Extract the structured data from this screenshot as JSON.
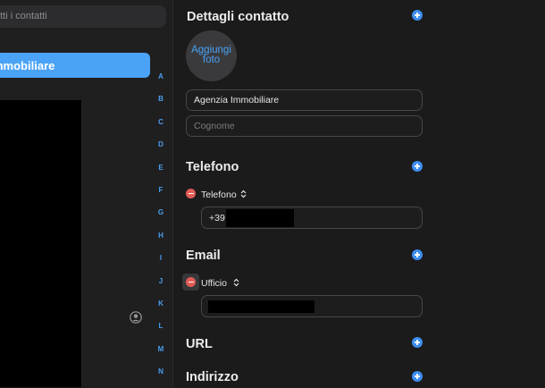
{
  "sidebar": {
    "search_placeholder": "utti i contatti",
    "selected_contact": "mmobiliare",
    "index_letters": [
      "A",
      "B",
      "C",
      "D",
      "E",
      "F",
      "G",
      "H",
      "I",
      "J",
      "K",
      "L",
      "M",
      "N"
    ],
    "me_icon": "person-circle-icon"
  },
  "details": {
    "title": "Dettagli contatto",
    "add_photo": "Aggiungi foto",
    "first_name": "Agenzia Immobiliare",
    "last_name_placeholder": "Cognome",
    "phone_section": "Telefono",
    "phone_label": "Telefono",
    "phone_value": "+39",
    "email_section": "Email",
    "email_label": "Ufficio",
    "url_section": "URL",
    "address_section": "Indirizzo",
    "accent_color": "#3d8ef0",
    "remove_color": "#e25b55"
  }
}
